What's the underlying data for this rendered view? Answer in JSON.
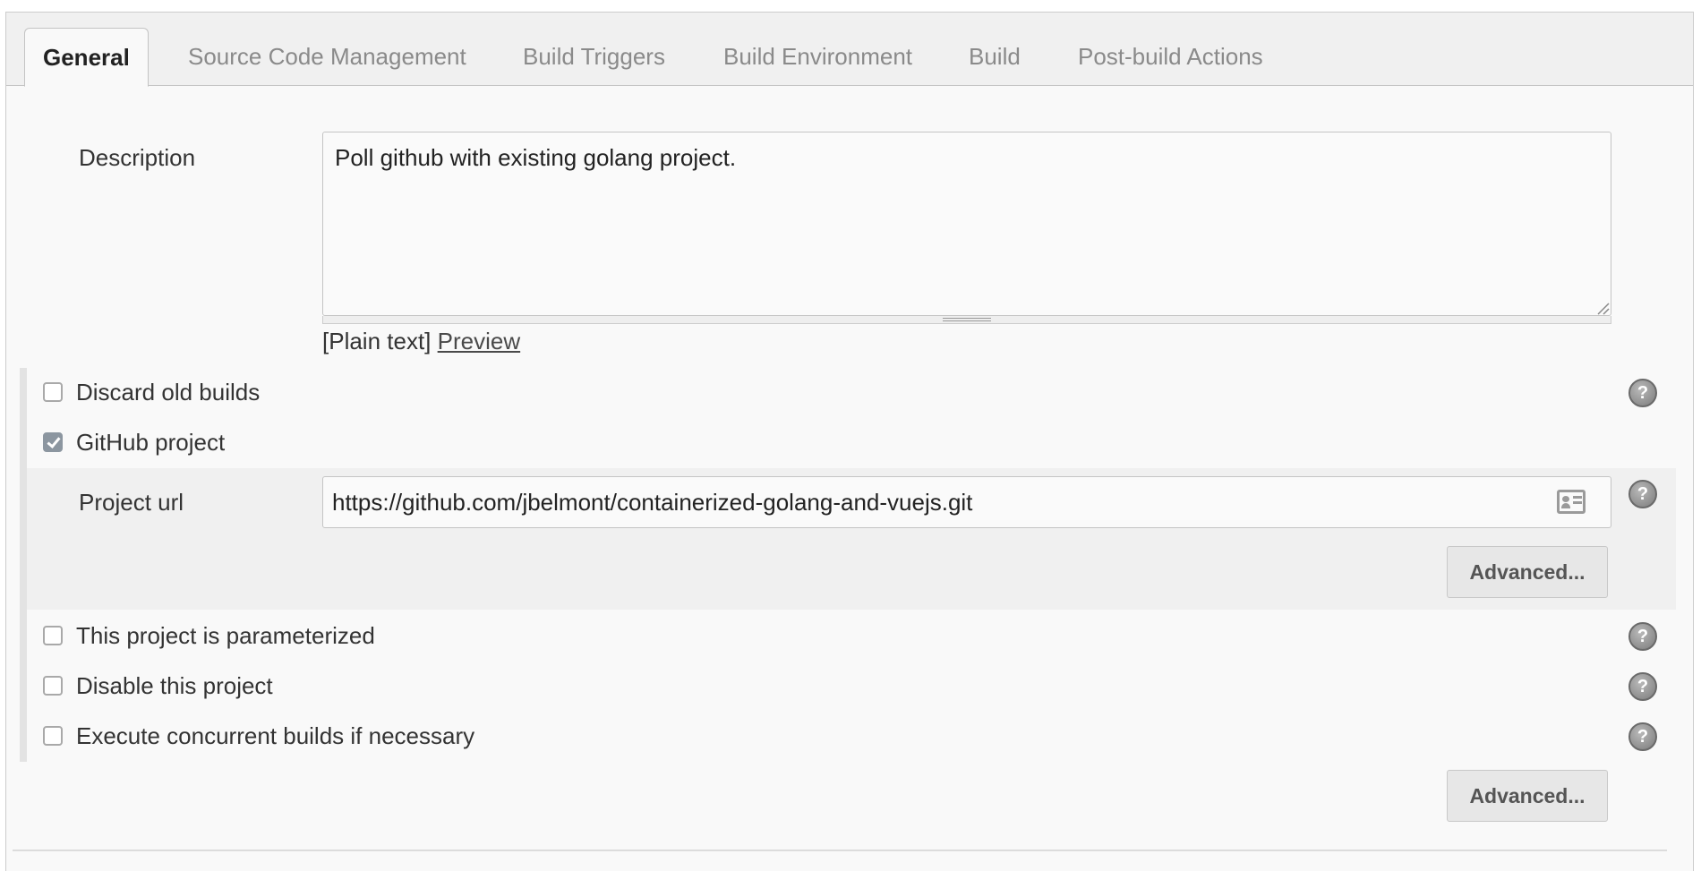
{
  "tabs": [
    {
      "label": "General",
      "active": true
    },
    {
      "label": "Source Code Management",
      "active": false
    },
    {
      "label": "Build Triggers",
      "active": false
    },
    {
      "label": "Build Environment",
      "active": false
    },
    {
      "label": "Build",
      "active": false
    },
    {
      "label": "Post-build Actions",
      "active": false
    }
  ],
  "description": {
    "label": "Description",
    "value": "Poll github with existing golang project.",
    "format_text": "[Plain text]",
    "preview_link": "Preview"
  },
  "options": {
    "discard_old_builds": {
      "label": "Discard old builds",
      "checked": false
    },
    "github_project": {
      "label": "GitHub project",
      "checked": true
    },
    "parameterized": {
      "label": "This project is parameterized",
      "checked": false
    },
    "disable_project": {
      "label": "Disable this project",
      "checked": false
    },
    "concurrent_builds": {
      "label": "Execute concurrent builds if necessary",
      "checked": false
    }
  },
  "project_url": {
    "label": "Project url",
    "value": "https://github.com/jbelmont/containerized-golang-and-vuejs.git"
  },
  "buttons": {
    "advanced_github": "Advanced...",
    "advanced_general": "Advanced..."
  },
  "help_icon_glyph": "?",
  "colors": {
    "panel_bg": "#f9f9f9",
    "tabbar_bg": "#f0f0f0",
    "checkbox_checked": "#8c96a0",
    "button_bg": "#e7e7e7"
  }
}
